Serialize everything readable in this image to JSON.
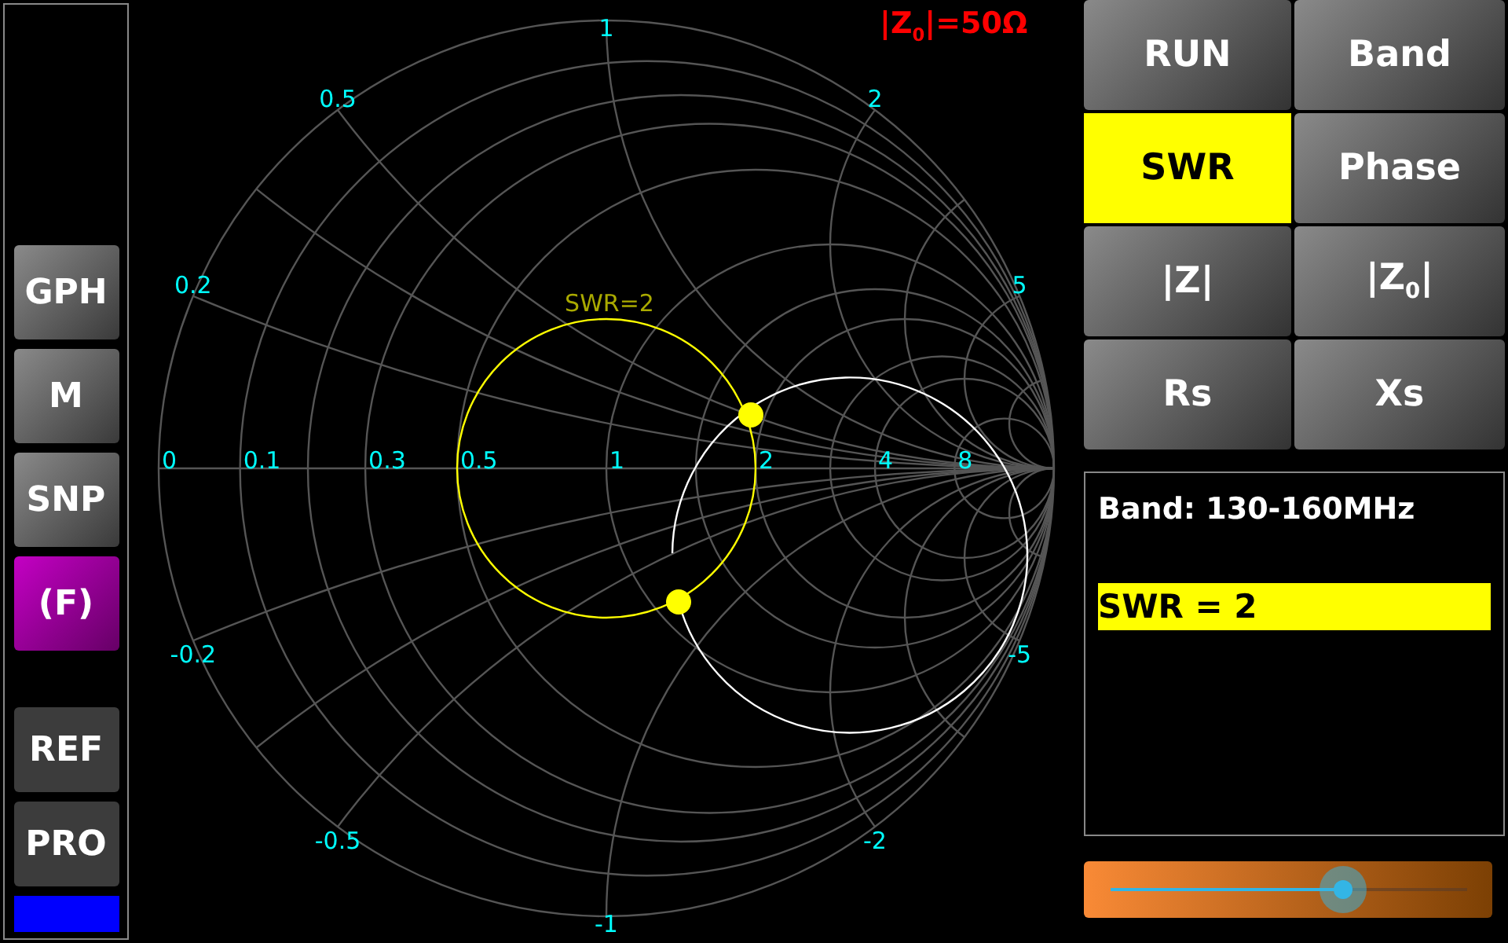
{
  "sidebar": {
    "buttons": [
      {
        "label": "GPH",
        "kind": "raised",
        "selected": false
      },
      {
        "label": "M",
        "kind": "raised",
        "selected": false
      },
      {
        "label": "SNP",
        "kind": "raised",
        "selected": false
      },
      {
        "label": "(F)",
        "kind": "raised",
        "selected": true
      },
      {
        "label": "REF",
        "kind": "flat",
        "selected": false
      },
      {
        "label": "PRO",
        "kind": "flat",
        "selected": false
      }
    ]
  },
  "chart": {
    "title": "|Z$_{0}$|=50Ω",
    "resistance_labels": [
      "0",
      "0.1",
      "0.3",
      "0.5",
      "1",
      "2",
      "4",
      "8"
    ],
    "reactance_labels": [
      "1",
      "0.5",
      "2",
      "0.2",
      "5",
      "-0.2",
      "-5",
      "-0.5",
      "-2",
      "-1"
    ],
    "swr_circle_label": "SWR=2"
  },
  "mode_buttons": [
    {
      "label": "RUN",
      "selected": false
    },
    {
      "label": "Band",
      "selected": false
    },
    {
      "label": "SWR",
      "selected": true
    },
    {
      "label": "Phase",
      "selected": false
    },
    {
      "label": "|Z|",
      "selected": false
    },
    {
      "label": "|Z$_{0}$|",
      "selected": false
    },
    {
      "label": "Rs",
      "selected": false
    },
    {
      "label": "Xs",
      "selected": false
    }
  ],
  "info_panel": {
    "band": "Band: 130-160MHz",
    "reading": "SWR = 2"
  },
  "slider": {
    "level": 0.65
  }
}
